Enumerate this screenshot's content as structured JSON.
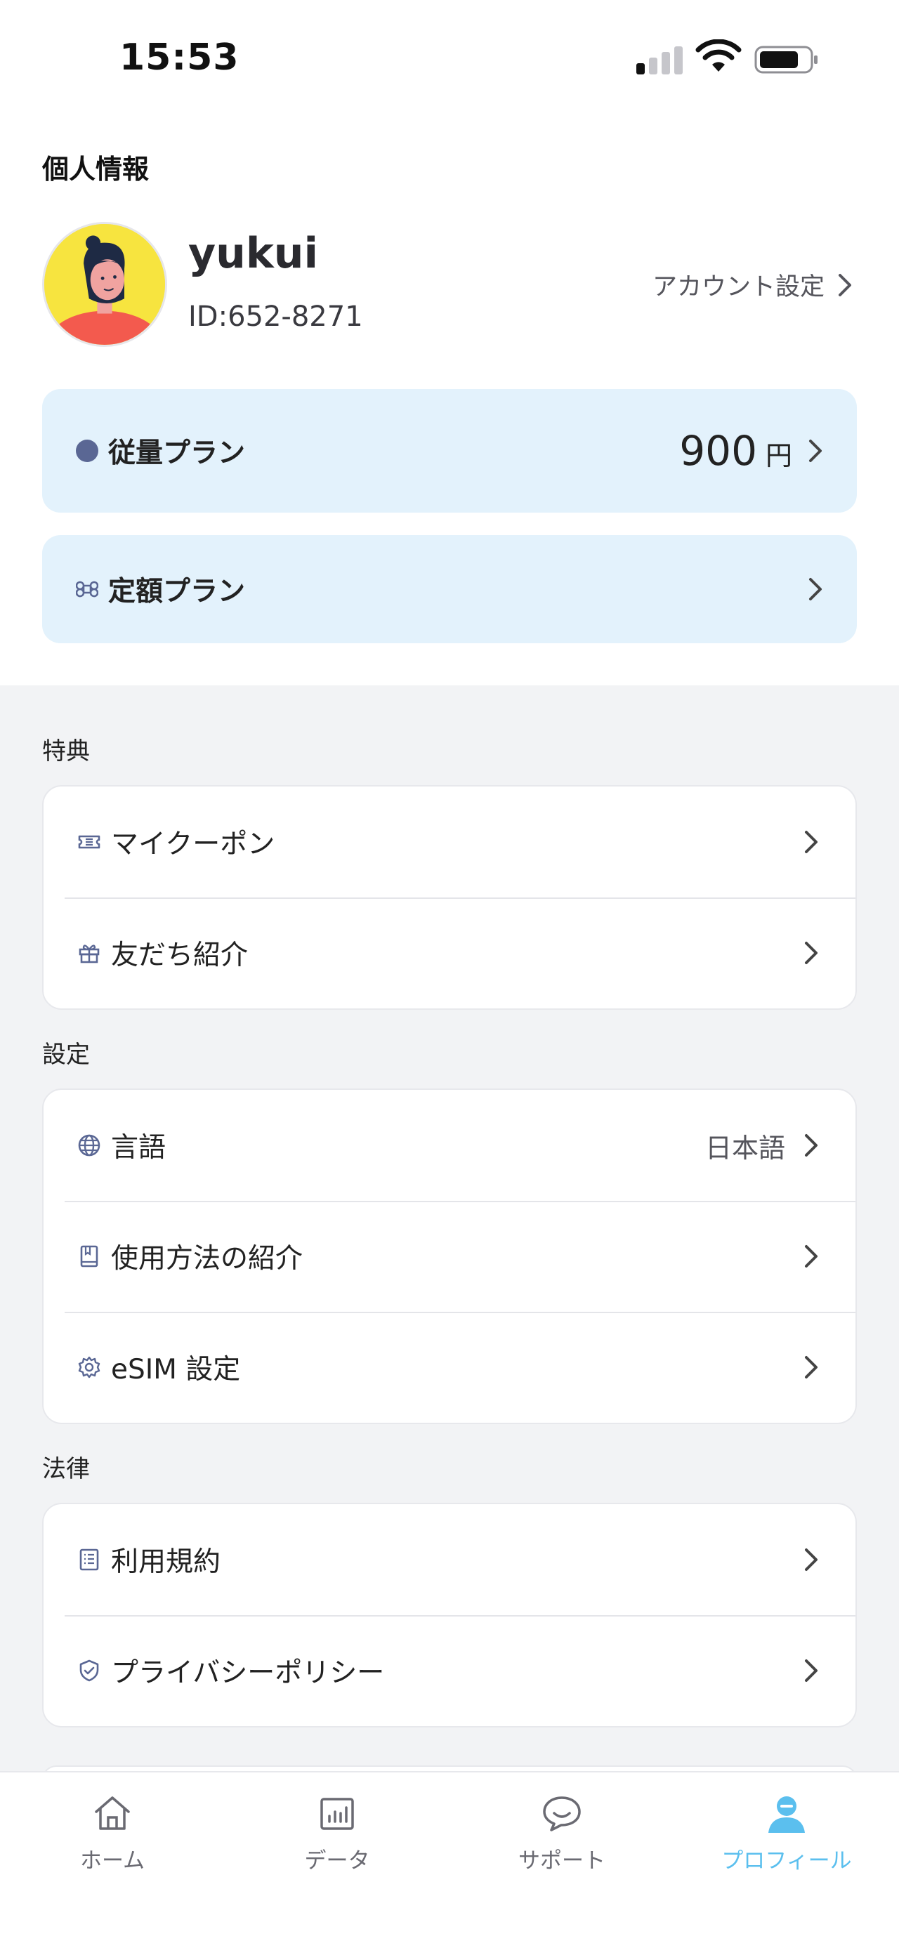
{
  "status_bar": {
    "time": "15:53"
  },
  "profile": {
    "section_title": "個人情報",
    "username": "yukui",
    "user_id": "ID:652-8271",
    "account_settings_label": "アカウント設定"
  },
  "plans": {
    "metered": {
      "label": "従量プラン",
      "amount": "900",
      "unit": "円"
    },
    "fixed": {
      "label": "定額プラン"
    }
  },
  "benefits": {
    "title": "特典",
    "items": [
      {
        "label": "マイクーポン",
        "icon": "ticket-icon"
      },
      {
        "label": "友だち紹介",
        "icon": "gift-icon"
      }
    ]
  },
  "settings": {
    "title": "設定",
    "items": [
      {
        "label": "言語",
        "value": "日本語",
        "icon": "globe-icon"
      },
      {
        "label": "使用方法の紹介",
        "icon": "book-icon"
      },
      {
        "label": "eSIM 設定",
        "icon": "gear-icon"
      }
    ]
  },
  "legal": {
    "title": "法律",
    "items": [
      {
        "label": "利用規約",
        "icon": "document-list-icon"
      },
      {
        "label": "プライバシーポリシー",
        "icon": "shield-check-icon"
      }
    ]
  },
  "tabbar": {
    "tabs": [
      {
        "label": "ホーム",
        "icon": "home-icon"
      },
      {
        "label": "データ",
        "icon": "chart-icon"
      },
      {
        "label": "サポート",
        "icon": "chat-bubble-icon"
      },
      {
        "label": "プロフィール",
        "icon": "person-icon",
        "active": true
      }
    ]
  },
  "colors": {
    "accent": "#5bbfee",
    "plan_card_bg": "#e3f2fc",
    "page_gray": "#f2f3f5",
    "icon_navy": "#5a6794"
  }
}
